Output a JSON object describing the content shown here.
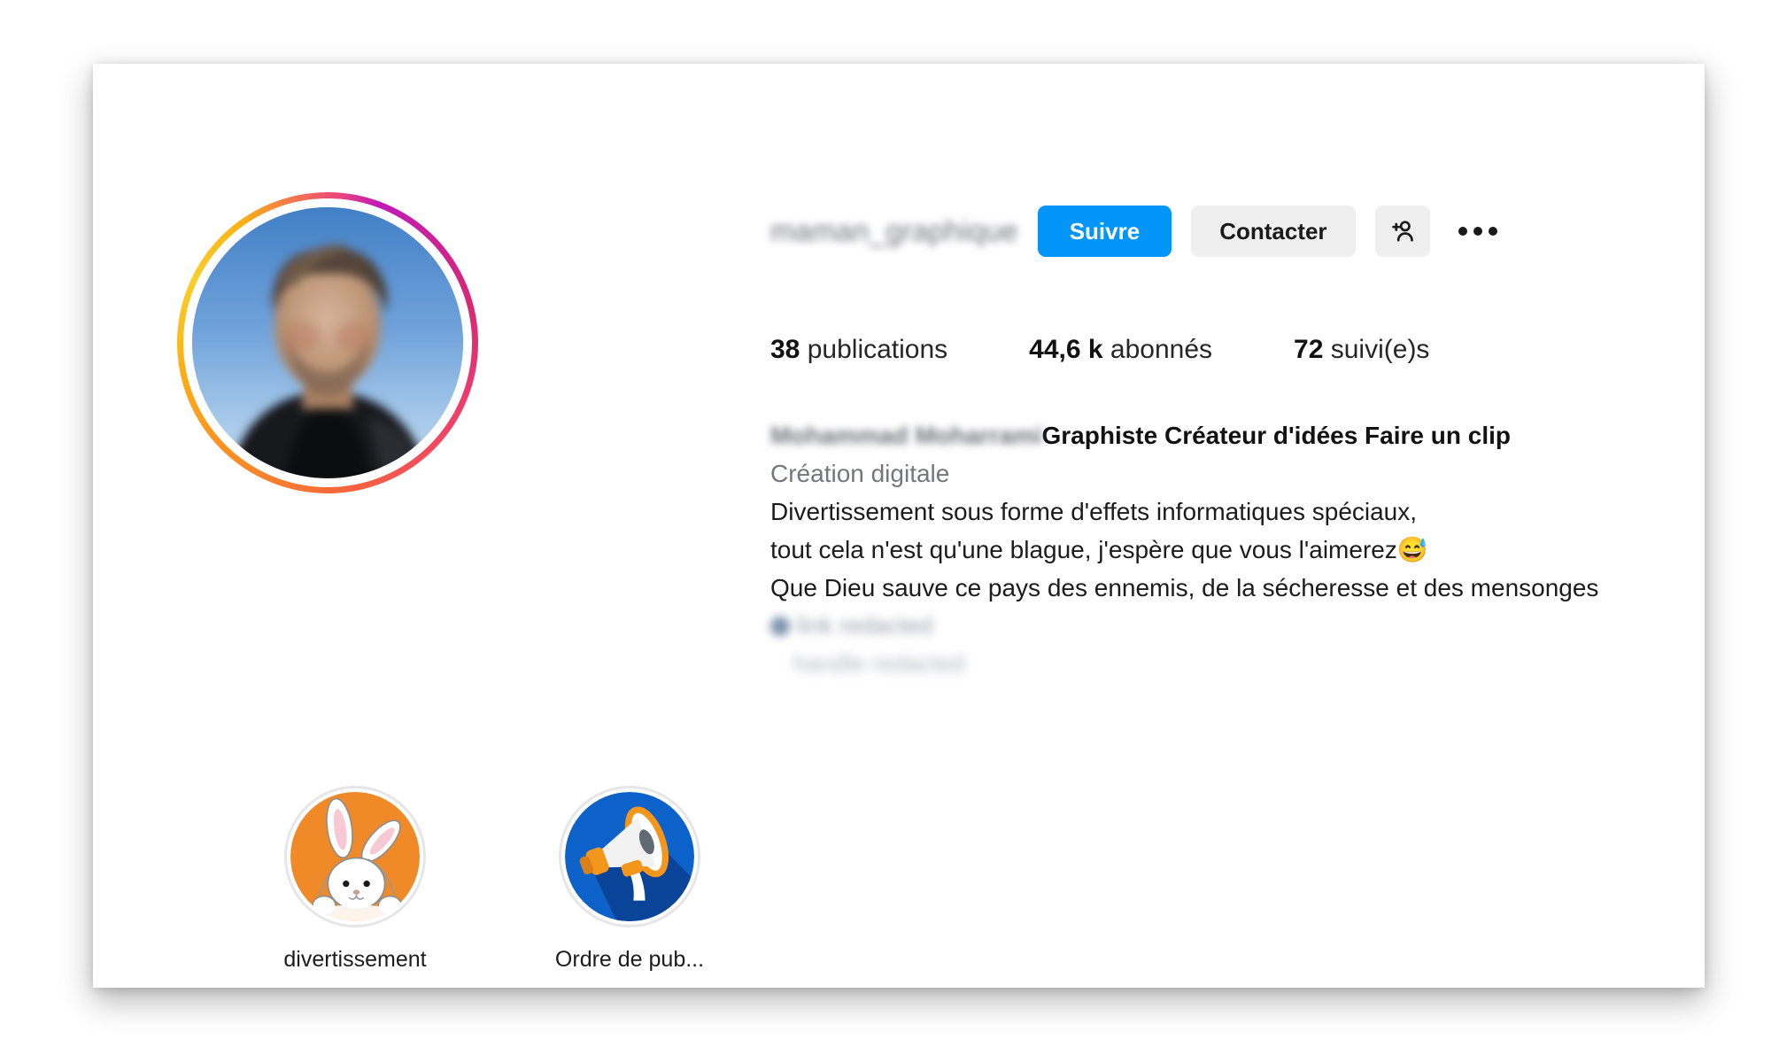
{
  "profile": {
    "username": "maman_graphique",
    "username_blurred": true,
    "actions": {
      "follow_label": "Suivre",
      "contact_label": "Contacter",
      "add_person_icon": "person-add-icon",
      "more_icon": "more-options-icon"
    },
    "stats": [
      {
        "value": "38",
        "label": "publications"
      },
      {
        "value": "44,6 k",
        "label": "abonnés"
      },
      {
        "value": "72",
        "label": "suivi(e)s"
      }
    ],
    "bio": {
      "display_name": "Mohammad Moharrami",
      "display_name_blurred": true,
      "headline": "Graphiste Créateur d'idées Faire un clip",
      "category": "Création digitale",
      "line_1": "Divertissement sous forme d'effets informatiques spéciaux,",
      "line_2": "tout cela n'est qu'une blague, j'espère que vous l'aimerez",
      "line_2_emoji": "😅",
      "line_3": "Que Dieu sauve ce pays des ennemis, de la sécheresse et des mensonges",
      "blurred_line_1": "link redacted",
      "blurred_line_2": "handle redacted"
    },
    "highlights": [
      {
        "label": "divertissement",
        "icon": "bunny-icon"
      },
      {
        "label": "Ordre de pub...",
        "icon": "megaphone-icon"
      }
    ]
  },
  "colors": {
    "accent_blue": "#0095F6",
    "button_gray": "#EFEFEF",
    "text_primary": "#1C1C1C",
    "text_secondary": "#73777C",
    "ring_magenta": "#C11AB8",
    "ring_pink": "#D62976",
    "ring_orange": "#F5623F",
    "ring_yellow": "#FCAF17",
    "highlight_orange": "#F08A28",
    "highlight_blue": "#0D62C9"
  }
}
